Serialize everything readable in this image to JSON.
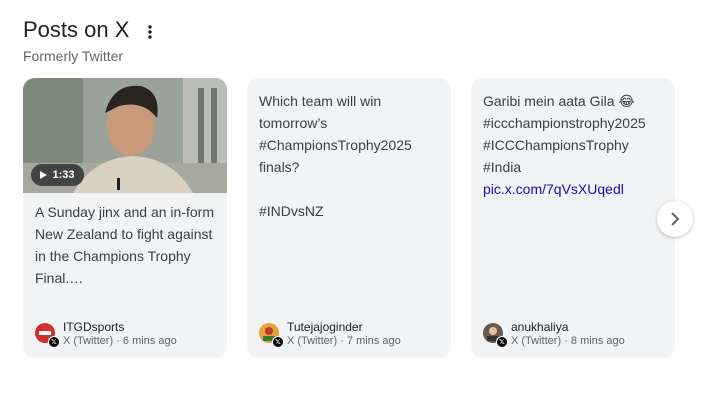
{
  "header": {
    "title": "Posts on X",
    "subtitle": "Formerly Twitter",
    "menu_icon": "more-vert-icon"
  },
  "cards": [
    {
      "has_video": true,
      "duration": "1:33",
      "text": "A Sunday jinx and an in-form\nNew Zealand to fight against\nin the Champions Trophy\nFinal.…",
      "link": "",
      "author": "ITGDsports",
      "source": "X (Twitter)",
      "time": "6 mins ago",
      "avatar_color": "#d32f2f"
    },
    {
      "has_video": false,
      "text": "Which team will win\ntomorrow’s\n#ChampionsTrophy2025\nfinals?\n\n#INDvsNZ",
      "link": "",
      "author": "Tutejajoginder",
      "source": "X (Twitter)",
      "time": "7 mins ago",
      "avatar_color": "#e6a23c"
    },
    {
      "has_video": false,
      "text": "Garibi mein aata Gila 😂\n#iccchampionstrophy2025\n#ICCChampionsTrophy\n#India",
      "link": "pic.x.com/7qVsXUqedl",
      "author": "anukhaliya",
      "source": "X (Twitter)",
      "time": "8 mins ago",
      "avatar_color": "#6d5a4a"
    }
  ],
  "separator": " · ",
  "next_icon": "chevron-right-icon",
  "colors": {
    "card_bg": "#f1f3f4",
    "link": "#1a0dab",
    "muted": "#5f6368"
  }
}
